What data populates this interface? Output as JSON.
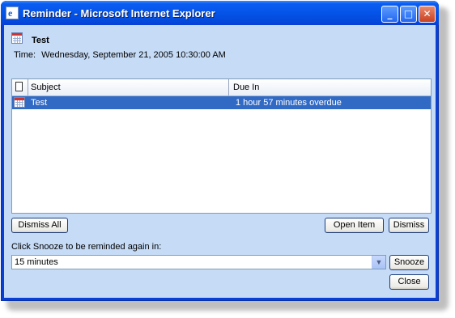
{
  "window": {
    "title": "Reminder - Microsoft Internet Explorer",
    "minimize_glyph": "_",
    "maximize_glyph": "□",
    "close_glyph": "✕"
  },
  "reminder": {
    "subject": "Test",
    "time_label": "Time:",
    "time_value": "Wednesday, September 21, 2005 10:30:00 AM"
  },
  "list": {
    "columns": [
      "Subject",
      "Due In"
    ],
    "rows": [
      {
        "subject": "Test",
        "due_in": "1 hour 57 minutes overdue",
        "selected": true,
        "icon": "calendar-icon"
      }
    ]
  },
  "buttons": {
    "dismiss_all": "Dismiss All",
    "open_item": "Open Item",
    "dismiss": "Dismiss",
    "snooze": "Snooze",
    "close": "Close"
  },
  "snooze": {
    "label": "Click Snooze to be reminded again in:",
    "selected": "15 minutes",
    "arrow_glyph": "▼"
  },
  "colors": {
    "titlebar": "#0554e8",
    "client_bg": "#c6dbf6",
    "selection": "#316ac5"
  }
}
